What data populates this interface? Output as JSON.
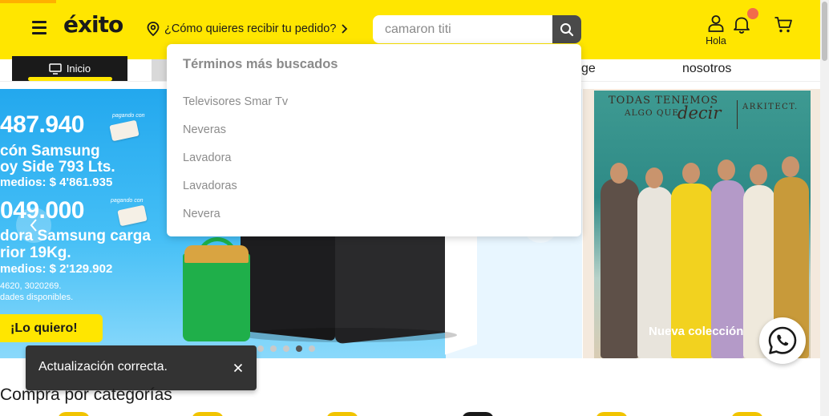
{
  "header": {
    "logo_text": "éxito",
    "delivery_prompt": "¿Cómo quieres recibir tu pedido?",
    "search_value": "camaron titi",
    "user_label": "Hola",
    "bell_has_notification": true,
    "colors": {
      "brand_yellow": "#ffe600",
      "notification": "#f26b4a",
      "search_button": "#4a4a4a"
    }
  },
  "subnav": {
    "inicio_label": "Inicio",
    "partial_label_1": "ge",
    "partial_label_2": "nosotros"
  },
  "search_dropdown": {
    "title": "Términos más buscados",
    "items": [
      "Televisores Smar Tv",
      "Neveras",
      "Lavadora",
      "Lavadoras",
      "Nevera"
    ]
  },
  "hero_banner": {
    "price_1": "487.940",
    "paying_with_1": "pagando con",
    "line_1": "cón Samsung",
    "line_2": "oy Side 793 Lts.",
    "line_3": "medios: $ 4'861.935",
    "price_2": "049.000",
    "paying_with_2": "pagando con",
    "line_4": "dora Samsung carga",
    "line_5": "rior 19Kg.",
    "line_6": "medios: $ 2'129.902",
    "small_1": "4620, 3020269.",
    "small_2": "dades disponibles.",
    "cta": "¡Lo quiero!",
    "carousel_dots": 5,
    "active_dot": 3
  },
  "promo_banner": {
    "text_1": "TODAS TENEMOS",
    "text_2": "ALGO QUE",
    "text_script": "decir",
    "brand": "ARKITECT.",
    "cta": "Nueva colección"
  },
  "toast": {
    "message": "Actualización correcta."
  },
  "categories": {
    "title": "Compra por categorías"
  }
}
